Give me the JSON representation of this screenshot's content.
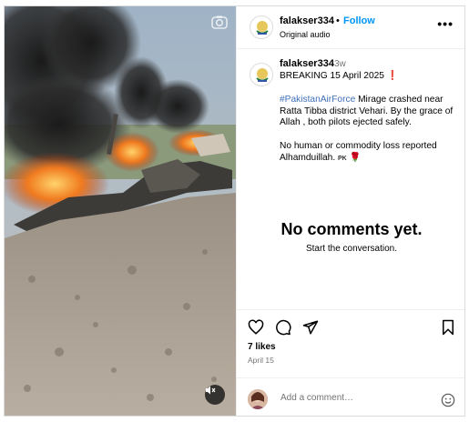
{
  "header": {
    "username": "falakser334",
    "separator": "•",
    "follow_label": "Follow",
    "audio_label": "Original audio",
    "more_label": "•••"
  },
  "caption": {
    "username": "falakser334",
    "time_ago": "3w",
    "line1": "BREAKING 15 April 2025",
    "line1_emoji": "❗",
    "hashtag": "#PakistanAirForce",
    "line2_rest": " Mirage crashed near Ratta Tibba district Vehari. By the grace of Allah , both pilots ejected safely.",
    "line3": "No human or commodity loss reported Alhamduillah.",
    "flag_text": "PK",
    "flag_emoji": "🌹"
  },
  "comments": {
    "empty_title": "No comments yet.",
    "empty_subtitle": "Start the conversation."
  },
  "stats": {
    "likes": "7 likes",
    "date": "April 15"
  },
  "comment_box": {
    "placeholder": "Add a comment…"
  },
  "colors": {
    "accent": "#0095f6",
    "hashtag": "#3f6fba",
    "muted": "#737373",
    "border": "#dbdbdb"
  },
  "icons": {
    "camera": "instagram-camera-icon",
    "mute": "volume-muted-icon",
    "like": "heart-icon",
    "comment": "comment-bubble-icon",
    "share": "paper-plane-icon",
    "save": "bookmark-icon",
    "emoji": "emoji-smile-icon",
    "more": "more-options-icon"
  }
}
